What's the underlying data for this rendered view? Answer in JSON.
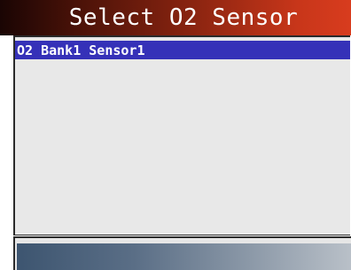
{
  "header": {
    "title": "Select O2 Sensor"
  },
  "sensor_list": {
    "items": [
      {
        "label": "O2 Bank1 Sensor1",
        "selected": true
      }
    ]
  },
  "colors": {
    "title_gradient_start": "#1a0504",
    "title_gradient_end": "#d83c1e",
    "selection_highlight": "#3531b8",
    "list_background": "#e8e8e8",
    "status_gradient_start": "#3d5570",
    "status_gradient_end": "#b9c0c8"
  }
}
